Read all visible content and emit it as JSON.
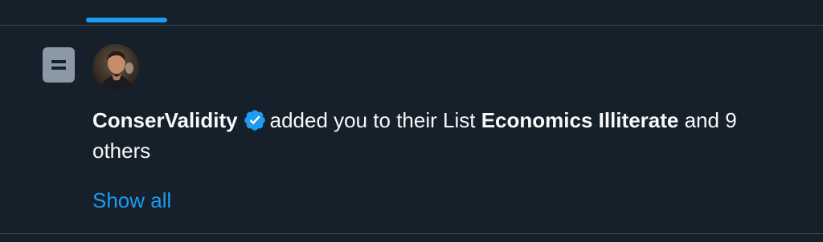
{
  "notification": {
    "user_name": "ConserValidity",
    "action_text": "added you to their List",
    "list_name": "Economics Illiterate",
    "suffix_text": "and 9 others",
    "show_all_label": "Show all"
  },
  "icons": {
    "list": "list-icon",
    "verified": "verified-badge-icon",
    "avatar": "avatar"
  },
  "colors": {
    "background": "#15202b",
    "accent": "#1d9bf0",
    "text": "#f7f9f9",
    "list_icon_bg": "#8b98a5"
  }
}
